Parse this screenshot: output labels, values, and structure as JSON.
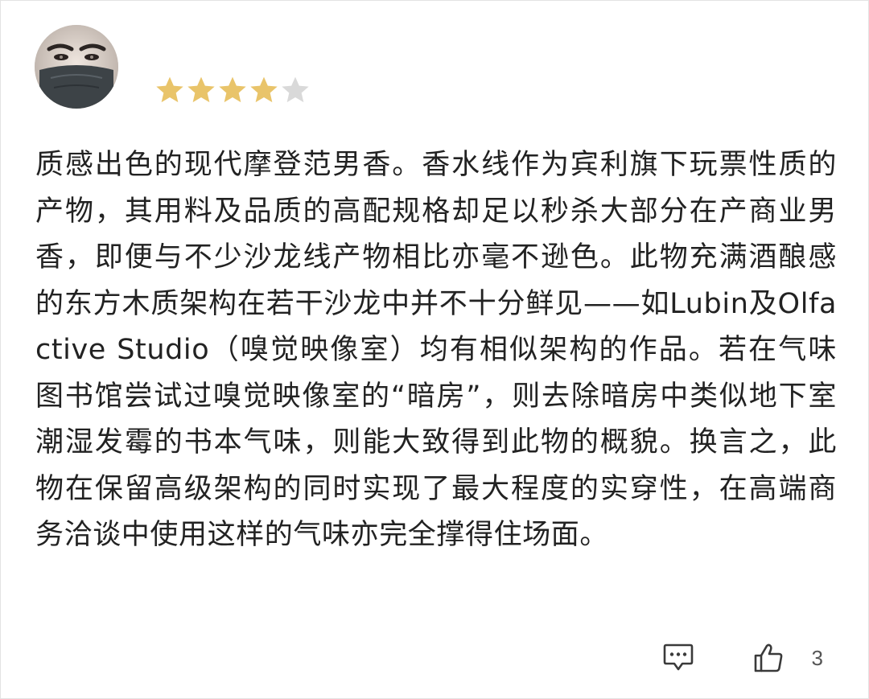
{
  "user": {
    "avatar_icon": "masked-face-avatar"
  },
  "rating": {
    "value": 4,
    "max": 5,
    "filled_color": "#E9C46A",
    "empty_color": "#D9D9D9"
  },
  "review": {
    "text": "质感出色的现代摩登范男香。香水线作为宾利旗下玩票性质的产物，其用料及品质的高配规格却足以秒杀大部分在产商业男香，即便与不少沙龙线产物相比亦毫不逊色。此物充满酒酿感的东方木质架构在若干沙龙中并不十分鲜见——如Lubin及Olfactive Studio（嗅觉映像室）均有相似架构的作品。若在气味图书馆尝试过嗅觉映像室的“暗房”，则去除暗房中类似地下室潮湿发霉的书本气味，则能大致得到此物的概貌。换言之，此物在保留高级架构的同时实现了最大程度的实穿性，在高端商务洽谈中使用这样的气味亦完全撑得住场面。"
  },
  "actions": {
    "comment_icon": "comment-icon",
    "like_icon": "thumbs-up-icon",
    "like_count": "3"
  }
}
